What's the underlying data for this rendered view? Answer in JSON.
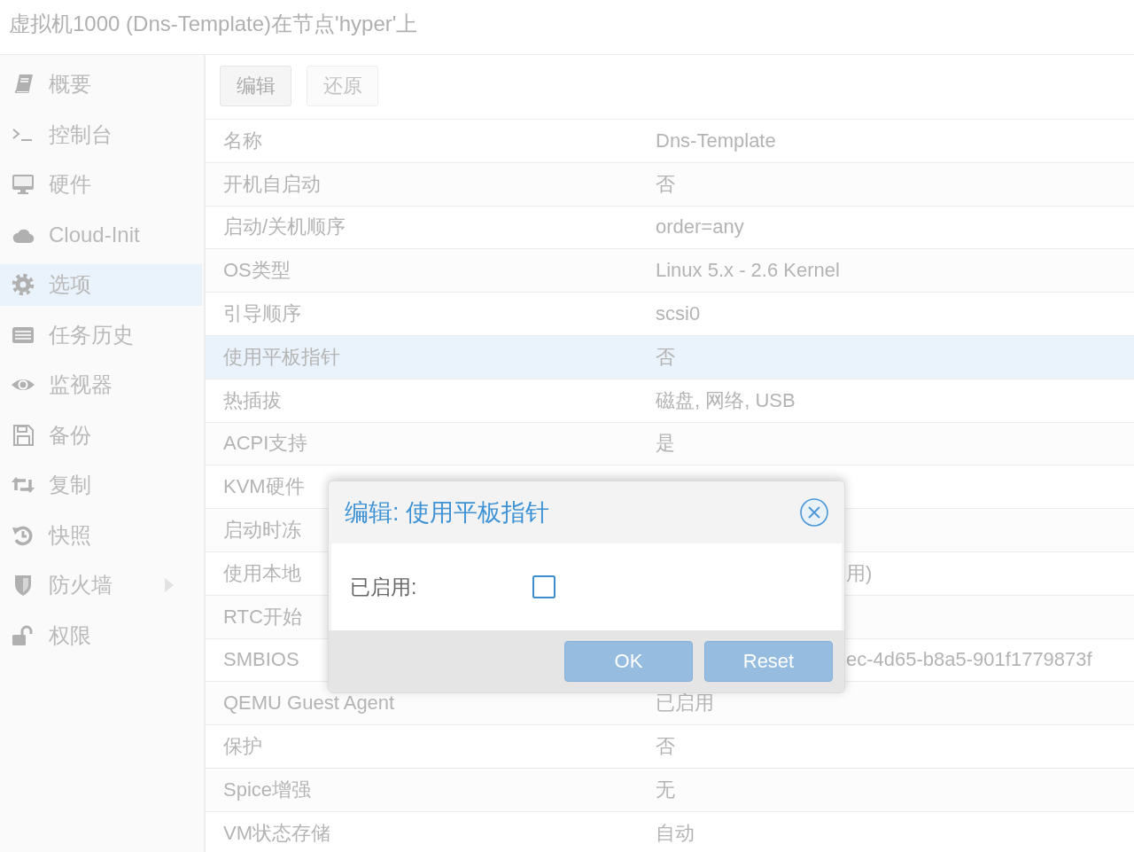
{
  "window": {
    "title": "虚拟机1000 (Dns-Template)在节点'hyper'上"
  },
  "sidebar": {
    "items": [
      {
        "label": "概要",
        "selected": false
      },
      {
        "label": "控制台",
        "selected": false
      },
      {
        "label": "硬件",
        "selected": false
      },
      {
        "label": "Cloud-Init",
        "selected": false
      },
      {
        "label": "选项",
        "selected": true
      },
      {
        "label": "任务历史",
        "selected": false
      },
      {
        "label": "监视器",
        "selected": false
      },
      {
        "label": "备份",
        "selected": false
      },
      {
        "label": "复制",
        "selected": false
      },
      {
        "label": "快照",
        "selected": false
      },
      {
        "label": "防火墙",
        "selected": false,
        "expanded": false
      },
      {
        "label": "权限",
        "selected": false
      }
    ]
  },
  "toolbar": {
    "buttons": [
      {
        "label": "编辑",
        "disabled": false
      },
      {
        "label": "还原",
        "disabled": true
      }
    ]
  },
  "table": {
    "rows": [
      {
        "label": "名称",
        "value": "Dns-Template",
        "selected": false
      },
      {
        "label": "开机自启动",
        "value": "否",
        "selected": false
      },
      {
        "label": "启动/关机顺序",
        "value": "order=any",
        "selected": false
      },
      {
        "label": "OS类型",
        "value": "Linux 5.x - 2.6 Kernel",
        "selected": false
      },
      {
        "label": "引导顺序",
        "value": "scsi0",
        "selected": false
      },
      {
        "label": "使用平板指针",
        "value": "否",
        "selected": true
      },
      {
        "label": "热插拔",
        "value": "磁盘, 网络, USB",
        "selected": false
      },
      {
        "label": "ACPI支持",
        "value": "是",
        "selected": false
      },
      {
        "label": "KVM硬件",
        "selected": false
      },
      {
        "label": "启动时冻",
        "selected": false
      },
      {
        "label": "使用本地",
        "value": "用)",
        "value_covered": true,
        "selected": false
      },
      {
        "label": "RTC开始",
        "selected": false
      },
      {
        "label": "SMBIOS",
        "value": "ec-4d65-b8a5-901f1779873f",
        "value_covered": true,
        "selected": false
      },
      {
        "label": "QEMU Guest Agent",
        "value": "已启用",
        "selected": false
      },
      {
        "label": "保护",
        "value": "否",
        "selected": false
      },
      {
        "label": "Spice增强",
        "value": "无",
        "selected": false
      },
      {
        "label": "VM状态存储",
        "value": "自动",
        "selected": false
      }
    ]
  },
  "dialog": {
    "title": "编辑: 使用平板指针",
    "fields": [
      {
        "label": "已启用:",
        "kind": "checkbox",
        "checked": false
      }
    ],
    "buttons": [
      {
        "label": "OK",
        "disabled": true
      },
      {
        "label": "Reset",
        "disabled": true
      }
    ]
  }
}
